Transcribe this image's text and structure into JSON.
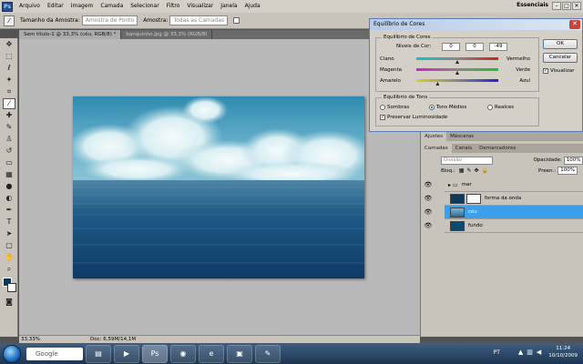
{
  "menu": {
    "app_icon": "Ps",
    "items": [
      "Arquivo",
      "Editar",
      "Imagem",
      "Camada",
      "Selecionar",
      "Filtro",
      "Visualizar",
      "Janela",
      "Ajuda"
    ],
    "workspace": "Essenciais",
    "window_controls": [
      "–",
      "□",
      "✕"
    ]
  },
  "options": {
    "sample_size_label": "Tamanho da Amostra:",
    "sample_size_value": "Amostra de Ponto",
    "sample_label": "Amostra:",
    "sample_value": "Todas as Camadas"
  },
  "tabs": [
    {
      "label": "Sem título-1 @ 33,3% (céu, RGB/8) *",
      "active": true
    },
    {
      "label": "banquinho.jpg @ 33,3% (RGB/8)",
      "active": false
    }
  ],
  "status": {
    "zoom": "33,33%",
    "doc": "Doc: 6,59M/14,1M"
  },
  "dialog": {
    "title": "Equilíbrio de Cores",
    "close": "✕",
    "color_balance_group": "Equilíbrio de Cores",
    "levels_label": "Níveis de Cor:",
    "levels": [
      "0",
      "0",
      "-49"
    ],
    "sliders": [
      {
        "left": "Ciano",
        "right": "Vermelho",
        "position": 0.5,
        "gradient": "linear-gradient(to right, #00c8c8, #888, #d02020)"
      },
      {
        "left": "Magenta",
        "right": "Verde",
        "position": 0.5,
        "gradient": "linear-gradient(to right, #d020d0, #888, #20c020)"
      },
      {
        "left": "Amarelo",
        "right": "Azul",
        "position": 0.26,
        "gradient": "linear-gradient(to right, #d8d020, #888, #2020d0)"
      }
    ],
    "tone_group": "Equilíbrio de Tons",
    "tones": [
      {
        "label": "Sombras",
        "on": false
      },
      {
        "label": "Tons Médios",
        "on": true
      },
      {
        "label": "Realces",
        "on": false
      }
    ],
    "preserve_label": "Preservar Luminosidade",
    "ok_label": "OK",
    "cancel_label": "Cancelar",
    "preview_label": "Visualizar"
  },
  "panels": {
    "adjust_tabs": [
      "Ajustes",
      "Máscaras"
    ],
    "layer_tabs": [
      "Camadas",
      "Canais",
      "Demarcadores"
    ],
    "blend_mode": "Divisão",
    "opacity_label": "Opacidade:",
    "opacity_value": "100%",
    "lock_label": "Bloq.:",
    "fill_label": "Preen.:",
    "fill_value": "100%",
    "layers": [
      {
        "name": "mar",
        "kind": "group",
        "selected": false
      },
      {
        "name": "forma da onda",
        "kind": "masked",
        "selected": false
      },
      {
        "name": "céu",
        "kind": "sky",
        "selected": true
      },
      {
        "name": "fundo",
        "kind": "solid",
        "selected": false
      }
    ]
  },
  "taskbar": {
    "search_placeholder": "Google",
    "apps": [
      "Explorer",
      "Media Player",
      "Photoshop",
      "Firefox",
      "Internet Explorer",
      "PowerPoint",
      "Paint"
    ],
    "language": "PT",
    "time": "11:24",
    "date": "10/10/2009"
  },
  "colors": {
    "foreground_swatch": "#0b3a5a",
    "background_swatch": "#ffffff",
    "selection_blue": "#3d9eea"
  }
}
